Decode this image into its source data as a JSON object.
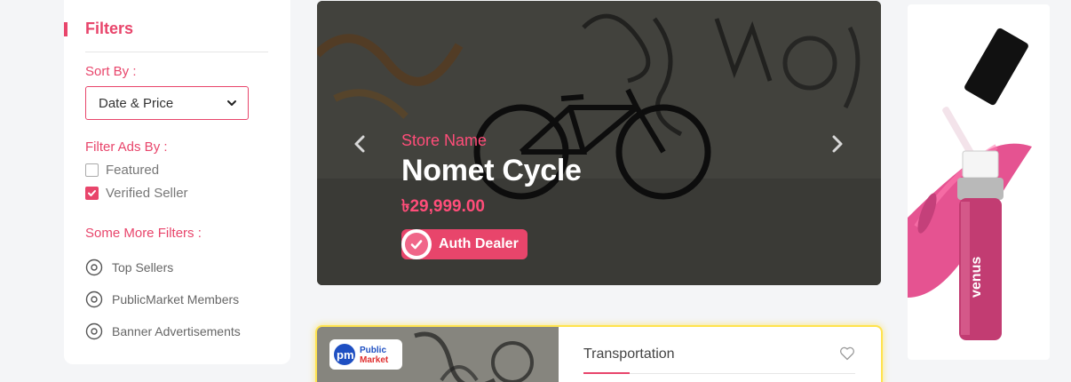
{
  "filters": {
    "title": "Filters",
    "sort_by_label": "Sort By :",
    "sort_selected": "Date & Price",
    "filter_ads_label": "Filter Ads By :",
    "checkboxes": [
      {
        "label": "Featured",
        "checked": false
      },
      {
        "label": "Verified Seller",
        "checked": true
      }
    ],
    "more_filters_label": "Some More Filters :",
    "more_filters": [
      {
        "label": "Top Sellers"
      },
      {
        "label": "PublicMarket Members"
      },
      {
        "label": "Banner Advertisements"
      }
    ]
  },
  "carousel": {
    "store_label": "Store Name",
    "product_name": "Nomet Cycle",
    "price": "৳29,999.00",
    "badge_label": "Auth Dealer"
  },
  "listing": {
    "category": "Transportation",
    "logo_text": [
      "Public",
      "Market"
    ],
    "logo_letters": "pm"
  },
  "ad": {
    "brand": "venus"
  },
  "colors": {
    "accent": "#e8456b",
    "highlight_border": "#ffe34d"
  }
}
